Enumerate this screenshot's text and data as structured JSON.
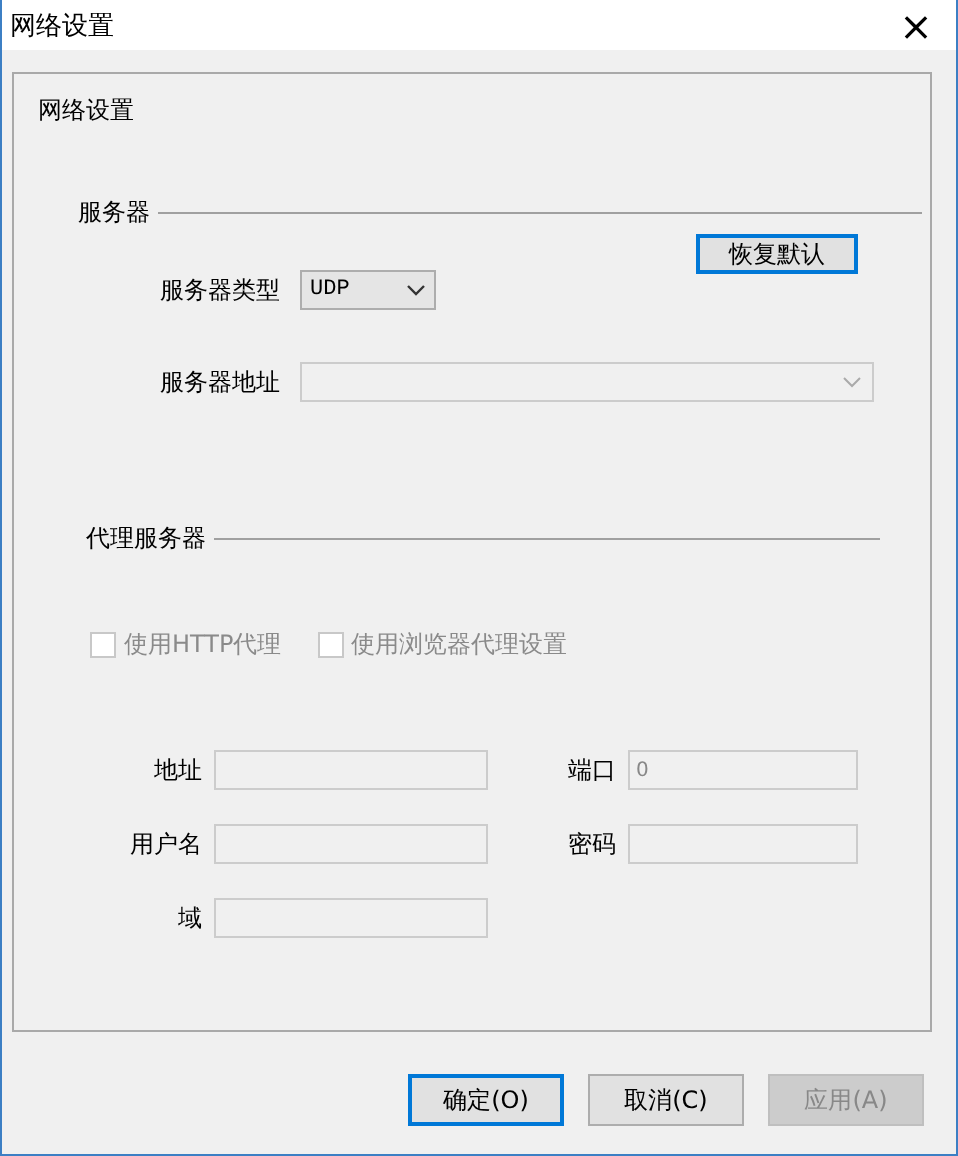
{
  "window": {
    "title": "网络设置",
    "close": "×"
  },
  "panel": {
    "caption": "网络设置"
  },
  "server": {
    "title": "服务器",
    "reset_button": {
      "label": "恢复默认",
      "focused": true
    },
    "type": {
      "label": "服务器类型",
      "value": "UDP"
    },
    "address": {
      "label": "服务器地址",
      "disabled": true
    }
  },
  "proxy": {
    "title": "代理服务器",
    "checkboxes": [
      {
        "label": "使用HTTP代理",
        "checked": false,
        "disabled": true
      },
      {
        "label": "使用浏览器代理设置",
        "checked": false,
        "disabled": true
      }
    ],
    "fields": [
      {
        "label": "地址",
        "disabled": true
      },
      {
        "label": "端口",
        "value": "0",
        "disabled": true
      },
      {
        "label": "用户名",
        "disabled": true
      },
      {
        "label": "密码",
        "disabled": true
      },
      {
        "label": "域",
        "disabled": true
      }
    ]
  },
  "buttons": [
    {
      "label": "确定(O)",
      "focused": true,
      "disabled": false
    },
    {
      "label": "取消(C)",
      "focused": false,
      "disabled": false
    },
    {
      "label": "应用(A)",
      "focused": false,
      "disabled": true
    }
  ]
}
